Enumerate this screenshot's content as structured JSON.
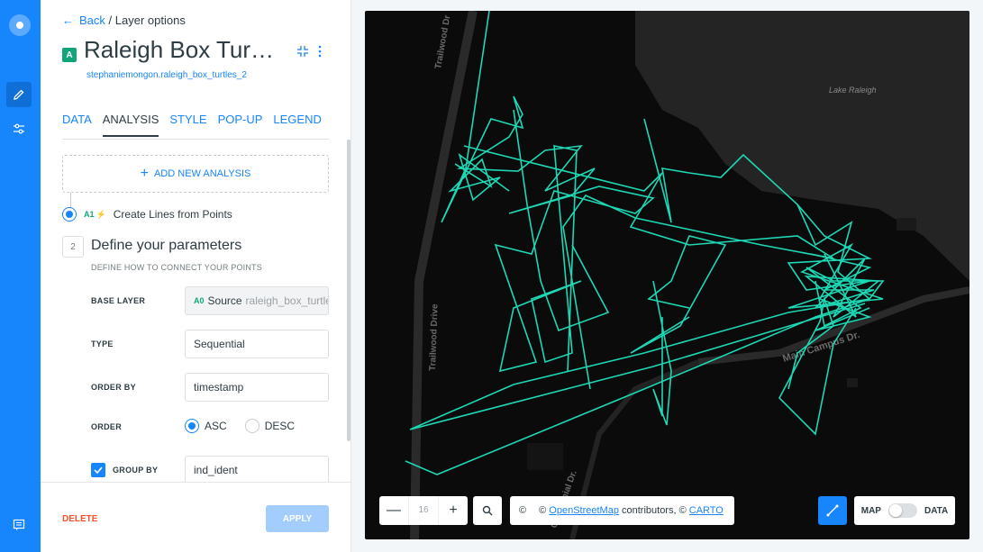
{
  "nav": {
    "back_label": "Back",
    "separator": "/",
    "current": "Layer options"
  },
  "layer": {
    "badge": "A",
    "title": "Raleigh Box Turtles",
    "dataset": "stephaniemongon.raleigh_box_turtles_2"
  },
  "tabs": [
    {
      "label": "DATA",
      "active": false
    },
    {
      "label": "ANALYSIS",
      "active": true
    },
    {
      "label": "STYLE",
      "active": false
    },
    {
      "label": "POP-UP",
      "active": false
    },
    {
      "label": "LEGEND",
      "active": false
    }
  ],
  "analysis": {
    "add_label": "ADD NEW ANALYSIS",
    "node_id": "A1",
    "node_label": "Create Lines from Points",
    "step_number": "2",
    "step_title": "Define your parameters",
    "step_subtitle": "DEFINE HOW TO CONNECT YOUR POINTS"
  },
  "params": {
    "base_layer_label": "BASE LAYER",
    "base_layer_id": "A0",
    "base_layer_source": "Source",
    "base_layer_name": "raleigh_box_turtles",
    "type_label": "TYPE",
    "type_value": "Sequential",
    "order_by_label": "ORDER BY",
    "order_by_value": "timestamp",
    "order_label": "ORDER",
    "order_asc": "ASC",
    "order_desc": "DESC",
    "order_selected": "ASC",
    "group_by_label": "GROUP BY",
    "group_by_checked": true,
    "group_by_value": "ind_ident"
  },
  "footer": {
    "delete_label": "DELETE",
    "apply_label": "APPLY"
  },
  "map": {
    "labels": {
      "lake": "Lake Raleigh",
      "road1": "Trailwood Drive",
      "road1_top": "Trailwood Dr",
      "road2": "Main Campus Dr.",
      "road3": "Centennial Dr."
    },
    "zoom_level": "16",
    "zoom_in": "+",
    "zoom_out": "—",
    "attribution_prefix": "©",
    "attribution_copy": "©",
    "attribution_osm": "OpenStreetMap",
    "attribution_mid": "contributors, ©",
    "attribution_carto": "CARTO",
    "toggle_map": "MAP",
    "toggle_data": "DATA",
    "line_color": "#1ed7b4"
  },
  "colors": {
    "brand": "#1785fb",
    "layer_badge": "#11a579",
    "delete": "#f3522b"
  }
}
